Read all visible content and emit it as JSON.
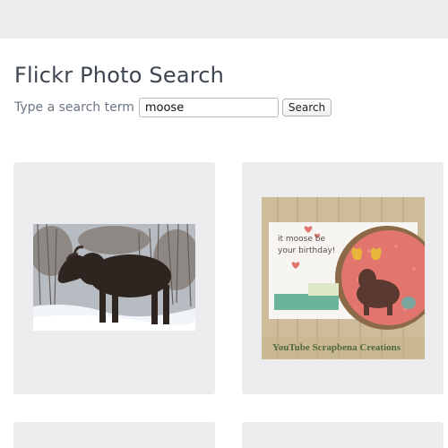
{
  "header": {
    "title": "Flickr Photo Search"
  },
  "search": {
    "label": "Type a search term",
    "value": "moose",
    "button_label": "Search"
  },
  "results": {
    "photo2": {
      "card_text_line1": "it moose be",
      "card_text_line2": "your birthday!",
      "watermark": "YouTube Scrapbena Creations"
    }
  },
  "colors": {
    "topbar": "#ececed",
    "card_bg": "#ececee",
    "title": "#3d4550",
    "label": "#6b7785"
  }
}
